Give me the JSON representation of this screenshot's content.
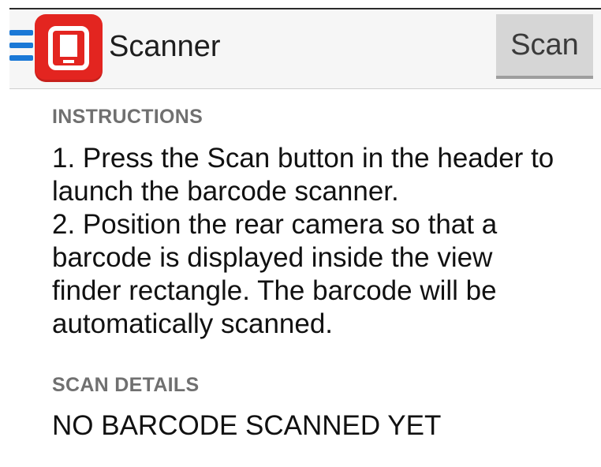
{
  "header": {
    "app_title": "Scanner",
    "scan_button_label": "Scan",
    "menu_icon": "hamburger-menu-icon",
    "app_icon": "mobile-device-icon",
    "app_icon_color": "#e32520",
    "menu_icon_color": "#1a78d6"
  },
  "instructions": {
    "heading": "INSTRUCTIONS",
    "lines": [
      "1. Press the Scan button in the header to",
      "launch the barcode scanner.",
      "2. Position the rear camera so that a",
      "barcode is displayed inside the view",
      "finder rectangle. The barcode will be",
      "automatically scanned."
    ]
  },
  "scan_details": {
    "heading": "SCAN DETAILS",
    "result_text": "NO BARCODE SCANNED YET"
  }
}
